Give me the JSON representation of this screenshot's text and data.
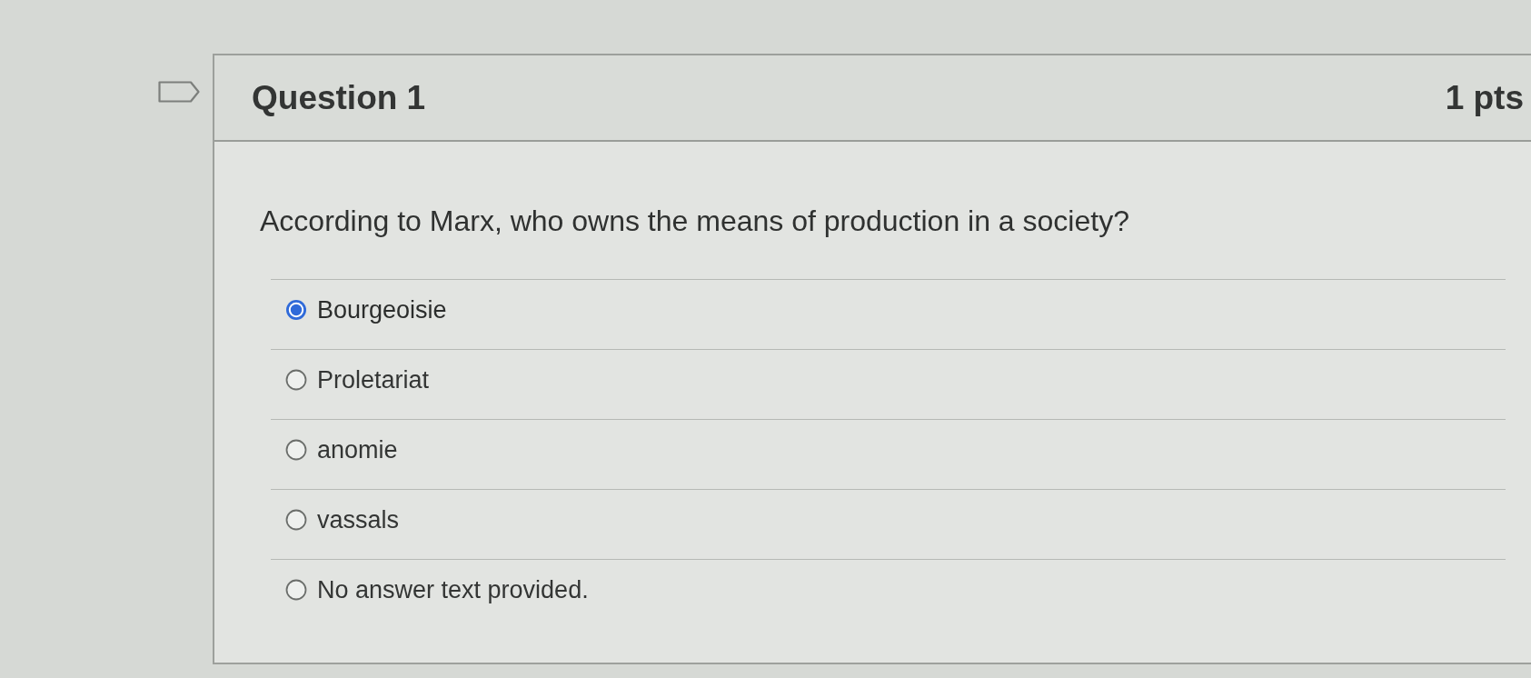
{
  "question": {
    "title": "Question 1",
    "points": "1 pts",
    "text": "According to Marx, who owns the means of production in a society?",
    "answers": [
      {
        "label": "Bourgeoisie",
        "selected": true
      },
      {
        "label": "Proletariat",
        "selected": false
      },
      {
        "label": "anomie",
        "selected": false
      },
      {
        "label": "vassals",
        "selected": false
      },
      {
        "label": "No answer text provided.",
        "selected": false
      }
    ]
  }
}
